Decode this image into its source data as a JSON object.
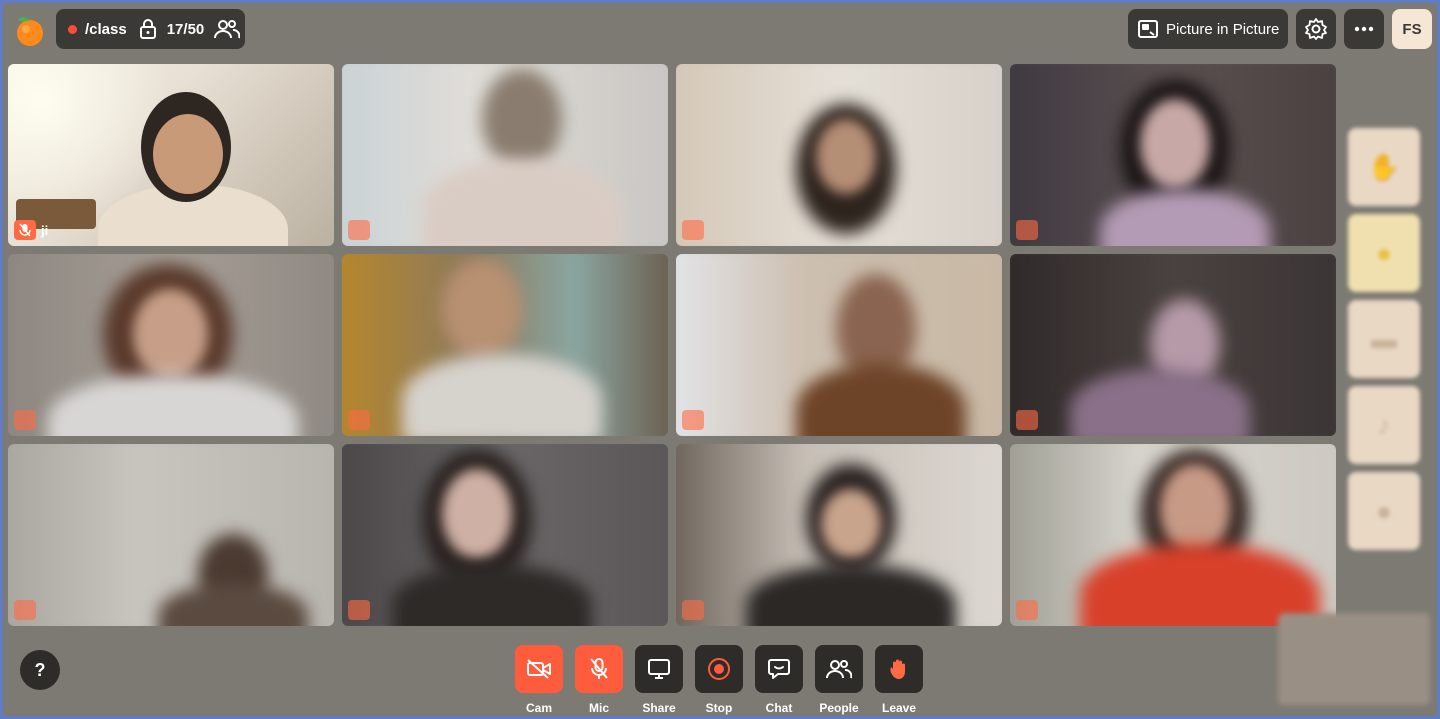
{
  "header": {
    "room_name": "/class",
    "participant_count": "17/50",
    "pip_label": "Picture in Picture",
    "user_initials": "FS"
  },
  "tiles": [
    {
      "name": "ji",
      "muted": true,
      "focused": true
    },
    {
      "name": "",
      "muted": true
    },
    {
      "name": "",
      "muted": true
    },
    {
      "name": "",
      "muted": true
    },
    {
      "name": "",
      "muted": true
    },
    {
      "name": "",
      "muted": true
    },
    {
      "name": "",
      "muted": true
    },
    {
      "name": "",
      "muted": true
    },
    {
      "name": "",
      "muted": true
    },
    {
      "name": "",
      "muted": true
    },
    {
      "name": "",
      "muted": true
    },
    {
      "name": "",
      "muted": true
    }
  ],
  "toolbar": {
    "help_label": "?",
    "cam_label": "Cam",
    "mic_label": "Mic",
    "share_label": "Share",
    "stop_label": "Stop",
    "chat_label": "Chat",
    "people_label": "People",
    "leave_label": "Leave"
  },
  "colors": {
    "accent": "#ff5b3d",
    "button_dark": "#2d2c29",
    "background": "#7c7a72"
  }
}
